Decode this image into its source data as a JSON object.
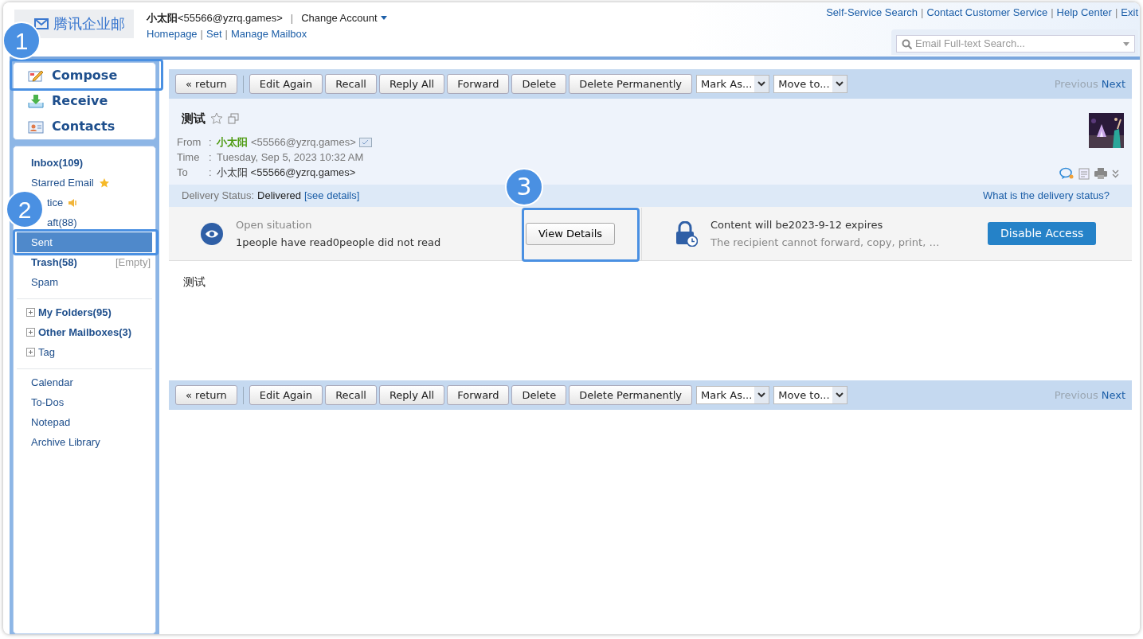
{
  "header": {
    "logo": "腾讯企业邮",
    "user_name": "小太阳",
    "user_email": "<55566@yzrq.games>",
    "separator": "|",
    "change_account": "Change Account",
    "links": [
      "Homepage",
      "Set",
      "Manage Mailbox"
    ],
    "top_links": [
      "Self-Service Search",
      "Contact Customer Service",
      "Help Center",
      "Exit"
    ],
    "search": {
      "placeholder": "Email Full-text Search..."
    }
  },
  "quick_actions": [
    {
      "label": "Compose",
      "kind": "compose",
      "callout": "1"
    },
    {
      "label": "Receive",
      "kind": "receive"
    },
    {
      "label": "Contacts",
      "kind": "contacts"
    }
  ],
  "sidebar_sections": [
    [
      {
        "label": "Inbox(109)",
        "kind": "plain",
        "bold": true,
        "selected": false
      },
      {
        "label": "Starred Email",
        "kind": "starred",
        "bold": false,
        "selected": false
      },
      {
        "label": "tice",
        "kind": "notice",
        "bold": false,
        "selected": false,
        "partly_hidden": true
      },
      {
        "label": "aft(88)",
        "kind": "plain",
        "bold": false,
        "selected": false,
        "partly_hidden": true
      },
      {
        "label": "Sent",
        "kind": "plain",
        "bold": false,
        "selected": true,
        "callout": "2"
      },
      {
        "label": "Trash(58)",
        "kind": "trash",
        "bold": true,
        "selected": false,
        "action": "[Empty]"
      },
      {
        "label": "Spam",
        "kind": "plain",
        "bold": false,
        "selected": false
      }
    ],
    [
      {
        "label": "My Folders(95)",
        "kind": "tree",
        "bold": true,
        "selected": false,
        "expanded": false
      },
      {
        "label": "Other Mailboxes(3)",
        "kind": "tree",
        "bold": true,
        "selected": false,
        "expanded": false
      },
      {
        "label": "Tag",
        "kind": "tree",
        "bold": false,
        "selected": false,
        "expanded": false
      }
    ],
    [
      {
        "label": "Calendar",
        "kind": "plain",
        "bold": false,
        "selected": false
      },
      {
        "label": "To-Dos",
        "kind": "plain",
        "bold": false,
        "selected": false
      },
      {
        "label": "Notepad",
        "kind": "plain",
        "bold": false,
        "selected": false
      },
      {
        "label": "Archive Library",
        "kind": "plain",
        "bold": false,
        "selected": false
      }
    ]
  ],
  "toolbars": [
    {
      "buttons": [
        "« return",
        "Edit Again",
        "Recall",
        "Reply All",
        "Forward",
        "Delete",
        "Delete Permanently"
      ],
      "selects": [
        "Mark As...",
        "Move to..."
      ],
      "nav": [
        {
          "label": "Previous",
          "disabled": true
        },
        {
          "label": "Next",
          "disabled": false
        }
      ]
    },
    {
      "buttons": [
        "« return",
        "Edit Again",
        "Recall",
        "Reply All",
        "Forward",
        "Delete",
        "Delete Permanently"
      ],
      "selects": [
        "Mark As...",
        "Move to..."
      ],
      "nav": [
        {
          "label": "Previous",
          "disabled": true
        },
        {
          "label": "Next",
          "disabled": false
        }
      ]
    }
  ],
  "email": {
    "subject": "测试",
    "starred": false,
    "fields": [
      {
        "label": "From",
        "sep": ":",
        "kind": "sender",
        "name": "小太阳",
        "value": "<55566@yzrq.games>"
      },
      {
        "label": "Time",
        "sep": ":",
        "kind": "plain",
        "value": "Tuesday, Sep 5, 2023 10:32 AM"
      },
      {
        "label": "To",
        "sep": ":",
        "kind": "plain",
        "value": "小太阳 <55566@yzrq.games>"
      }
    ],
    "delivery": {
      "label": "Delivery Status:",
      "value": "Delivered",
      "link": "[see details]",
      "help": "What is the delivery status?"
    },
    "read_status": {
      "title": "Open situation",
      "text": "1people have read0people did not read",
      "button": "View Details",
      "callout": "3"
    },
    "expiry": {
      "title": "Content will be2023-9-12 expires",
      "text": "The recipient cannot forward, copy, print, …",
      "button": "Disable Access"
    },
    "body": "测试"
  }
}
